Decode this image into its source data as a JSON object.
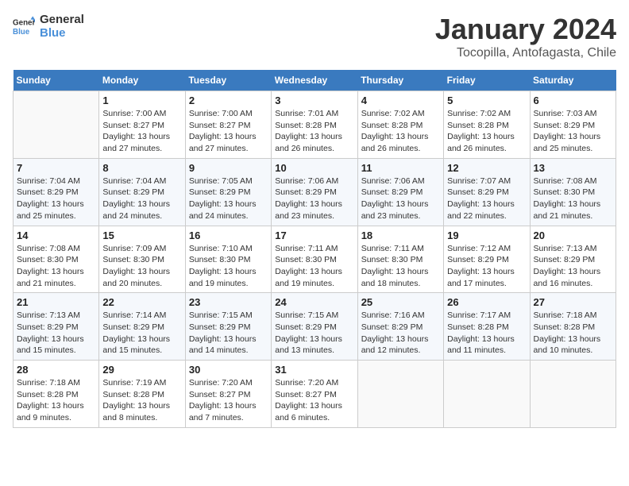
{
  "header": {
    "logo_line1": "General",
    "logo_line2": "Blue",
    "title": "January 2024",
    "location": "Tocopilla, Antofagasta, Chile"
  },
  "columns": [
    "Sunday",
    "Monday",
    "Tuesday",
    "Wednesday",
    "Thursday",
    "Friday",
    "Saturday"
  ],
  "weeks": [
    [
      {
        "day": "",
        "info": ""
      },
      {
        "day": "1",
        "info": "Sunrise: 7:00 AM\nSunset: 8:27 PM\nDaylight: 13 hours\nand 27 minutes."
      },
      {
        "day": "2",
        "info": "Sunrise: 7:00 AM\nSunset: 8:27 PM\nDaylight: 13 hours\nand 27 minutes."
      },
      {
        "day": "3",
        "info": "Sunrise: 7:01 AM\nSunset: 8:28 PM\nDaylight: 13 hours\nand 26 minutes."
      },
      {
        "day": "4",
        "info": "Sunrise: 7:02 AM\nSunset: 8:28 PM\nDaylight: 13 hours\nand 26 minutes."
      },
      {
        "day": "5",
        "info": "Sunrise: 7:02 AM\nSunset: 8:28 PM\nDaylight: 13 hours\nand 26 minutes."
      },
      {
        "day": "6",
        "info": "Sunrise: 7:03 AM\nSunset: 8:29 PM\nDaylight: 13 hours\nand 25 minutes."
      }
    ],
    [
      {
        "day": "7",
        "info": "Sunrise: 7:04 AM\nSunset: 8:29 PM\nDaylight: 13 hours\nand 25 minutes."
      },
      {
        "day": "8",
        "info": "Sunrise: 7:04 AM\nSunset: 8:29 PM\nDaylight: 13 hours\nand 24 minutes."
      },
      {
        "day": "9",
        "info": "Sunrise: 7:05 AM\nSunset: 8:29 PM\nDaylight: 13 hours\nand 24 minutes."
      },
      {
        "day": "10",
        "info": "Sunrise: 7:06 AM\nSunset: 8:29 PM\nDaylight: 13 hours\nand 23 minutes."
      },
      {
        "day": "11",
        "info": "Sunrise: 7:06 AM\nSunset: 8:29 PM\nDaylight: 13 hours\nand 23 minutes."
      },
      {
        "day": "12",
        "info": "Sunrise: 7:07 AM\nSunset: 8:29 PM\nDaylight: 13 hours\nand 22 minutes."
      },
      {
        "day": "13",
        "info": "Sunrise: 7:08 AM\nSunset: 8:30 PM\nDaylight: 13 hours\nand 21 minutes."
      }
    ],
    [
      {
        "day": "14",
        "info": "Sunrise: 7:08 AM\nSunset: 8:30 PM\nDaylight: 13 hours\nand 21 minutes."
      },
      {
        "day": "15",
        "info": "Sunrise: 7:09 AM\nSunset: 8:30 PM\nDaylight: 13 hours\nand 20 minutes."
      },
      {
        "day": "16",
        "info": "Sunrise: 7:10 AM\nSunset: 8:30 PM\nDaylight: 13 hours\nand 19 minutes."
      },
      {
        "day": "17",
        "info": "Sunrise: 7:11 AM\nSunset: 8:30 PM\nDaylight: 13 hours\nand 19 minutes."
      },
      {
        "day": "18",
        "info": "Sunrise: 7:11 AM\nSunset: 8:30 PM\nDaylight: 13 hours\nand 18 minutes."
      },
      {
        "day": "19",
        "info": "Sunrise: 7:12 AM\nSunset: 8:29 PM\nDaylight: 13 hours\nand 17 minutes."
      },
      {
        "day": "20",
        "info": "Sunrise: 7:13 AM\nSunset: 8:29 PM\nDaylight: 13 hours\nand 16 minutes."
      }
    ],
    [
      {
        "day": "21",
        "info": "Sunrise: 7:13 AM\nSunset: 8:29 PM\nDaylight: 13 hours\nand 15 minutes."
      },
      {
        "day": "22",
        "info": "Sunrise: 7:14 AM\nSunset: 8:29 PM\nDaylight: 13 hours\nand 15 minutes."
      },
      {
        "day": "23",
        "info": "Sunrise: 7:15 AM\nSunset: 8:29 PM\nDaylight: 13 hours\nand 14 minutes."
      },
      {
        "day": "24",
        "info": "Sunrise: 7:15 AM\nSunset: 8:29 PM\nDaylight: 13 hours\nand 13 minutes."
      },
      {
        "day": "25",
        "info": "Sunrise: 7:16 AM\nSunset: 8:29 PM\nDaylight: 13 hours\nand 12 minutes."
      },
      {
        "day": "26",
        "info": "Sunrise: 7:17 AM\nSunset: 8:28 PM\nDaylight: 13 hours\nand 11 minutes."
      },
      {
        "day": "27",
        "info": "Sunrise: 7:18 AM\nSunset: 8:28 PM\nDaylight: 13 hours\nand 10 minutes."
      }
    ],
    [
      {
        "day": "28",
        "info": "Sunrise: 7:18 AM\nSunset: 8:28 PM\nDaylight: 13 hours\nand 9 minutes."
      },
      {
        "day": "29",
        "info": "Sunrise: 7:19 AM\nSunset: 8:28 PM\nDaylight: 13 hours\nand 8 minutes."
      },
      {
        "day": "30",
        "info": "Sunrise: 7:20 AM\nSunset: 8:27 PM\nDaylight: 13 hours\nand 7 minutes."
      },
      {
        "day": "31",
        "info": "Sunrise: 7:20 AM\nSunset: 8:27 PM\nDaylight: 13 hours\nand 6 minutes."
      },
      {
        "day": "",
        "info": ""
      },
      {
        "day": "",
        "info": ""
      },
      {
        "day": "",
        "info": ""
      }
    ]
  ]
}
